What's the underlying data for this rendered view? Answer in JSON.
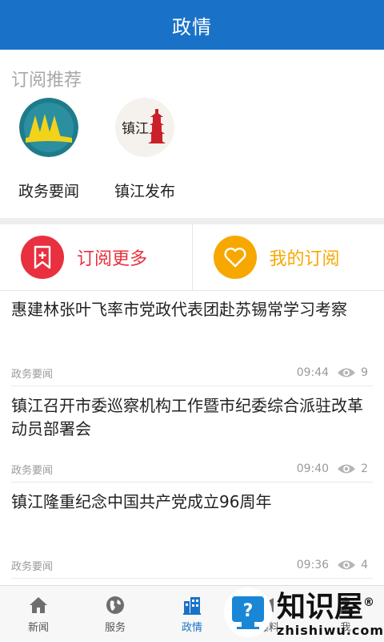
{
  "header": {
    "title": "政情"
  },
  "recommend": {
    "label": "订阅推荐",
    "items": [
      {
        "name": "政务要闻",
        "logo": "zhengwu-yaowen-logo"
      },
      {
        "name": "镇江发布",
        "logo": "zhenjiang-fabu-logo",
        "logo_text": "镇江"
      }
    ]
  },
  "actions": {
    "more": {
      "label": "订阅更多",
      "icon": "bookmark-plus-icon",
      "color": "#e8303f"
    },
    "mine": {
      "label": "我的订阅",
      "icon": "heart-icon",
      "color": "#f7a800"
    }
  },
  "news": [
    {
      "headline": "惠建林张叶飞率市党政代表团赴苏锡常学习考察",
      "source": "政务要闻",
      "time": "09:44",
      "views": "9"
    },
    {
      "headline": "镇江召开市委巡察机构工作暨市纪委综合派驻改革动员部署会",
      "source": "政务要闻",
      "time": "09:40",
      "views": "2"
    },
    {
      "headline": "镇江隆重纪念中国共产党成立96周年",
      "source": "政务要闻",
      "time": "09:36",
      "views": "4"
    }
  ],
  "tabs": [
    {
      "label": "新闻",
      "icon": "home-icon"
    },
    {
      "label": "服务",
      "icon": "globe-icon"
    },
    {
      "label": "政情",
      "icon": "building-icon",
      "active": true
    },
    {
      "label": "爆料",
      "icon": "megaphone-icon"
    },
    {
      "label": "我",
      "icon": "user-icon"
    }
  ],
  "watermark": {
    "title": "知识屋",
    "subtitle": "zhishiwu.com",
    "mark": "®",
    "badge_glyph": "?"
  },
  "colors": {
    "primary": "#1a72c8",
    "red": "#e8303f",
    "orange": "#f7a800"
  }
}
